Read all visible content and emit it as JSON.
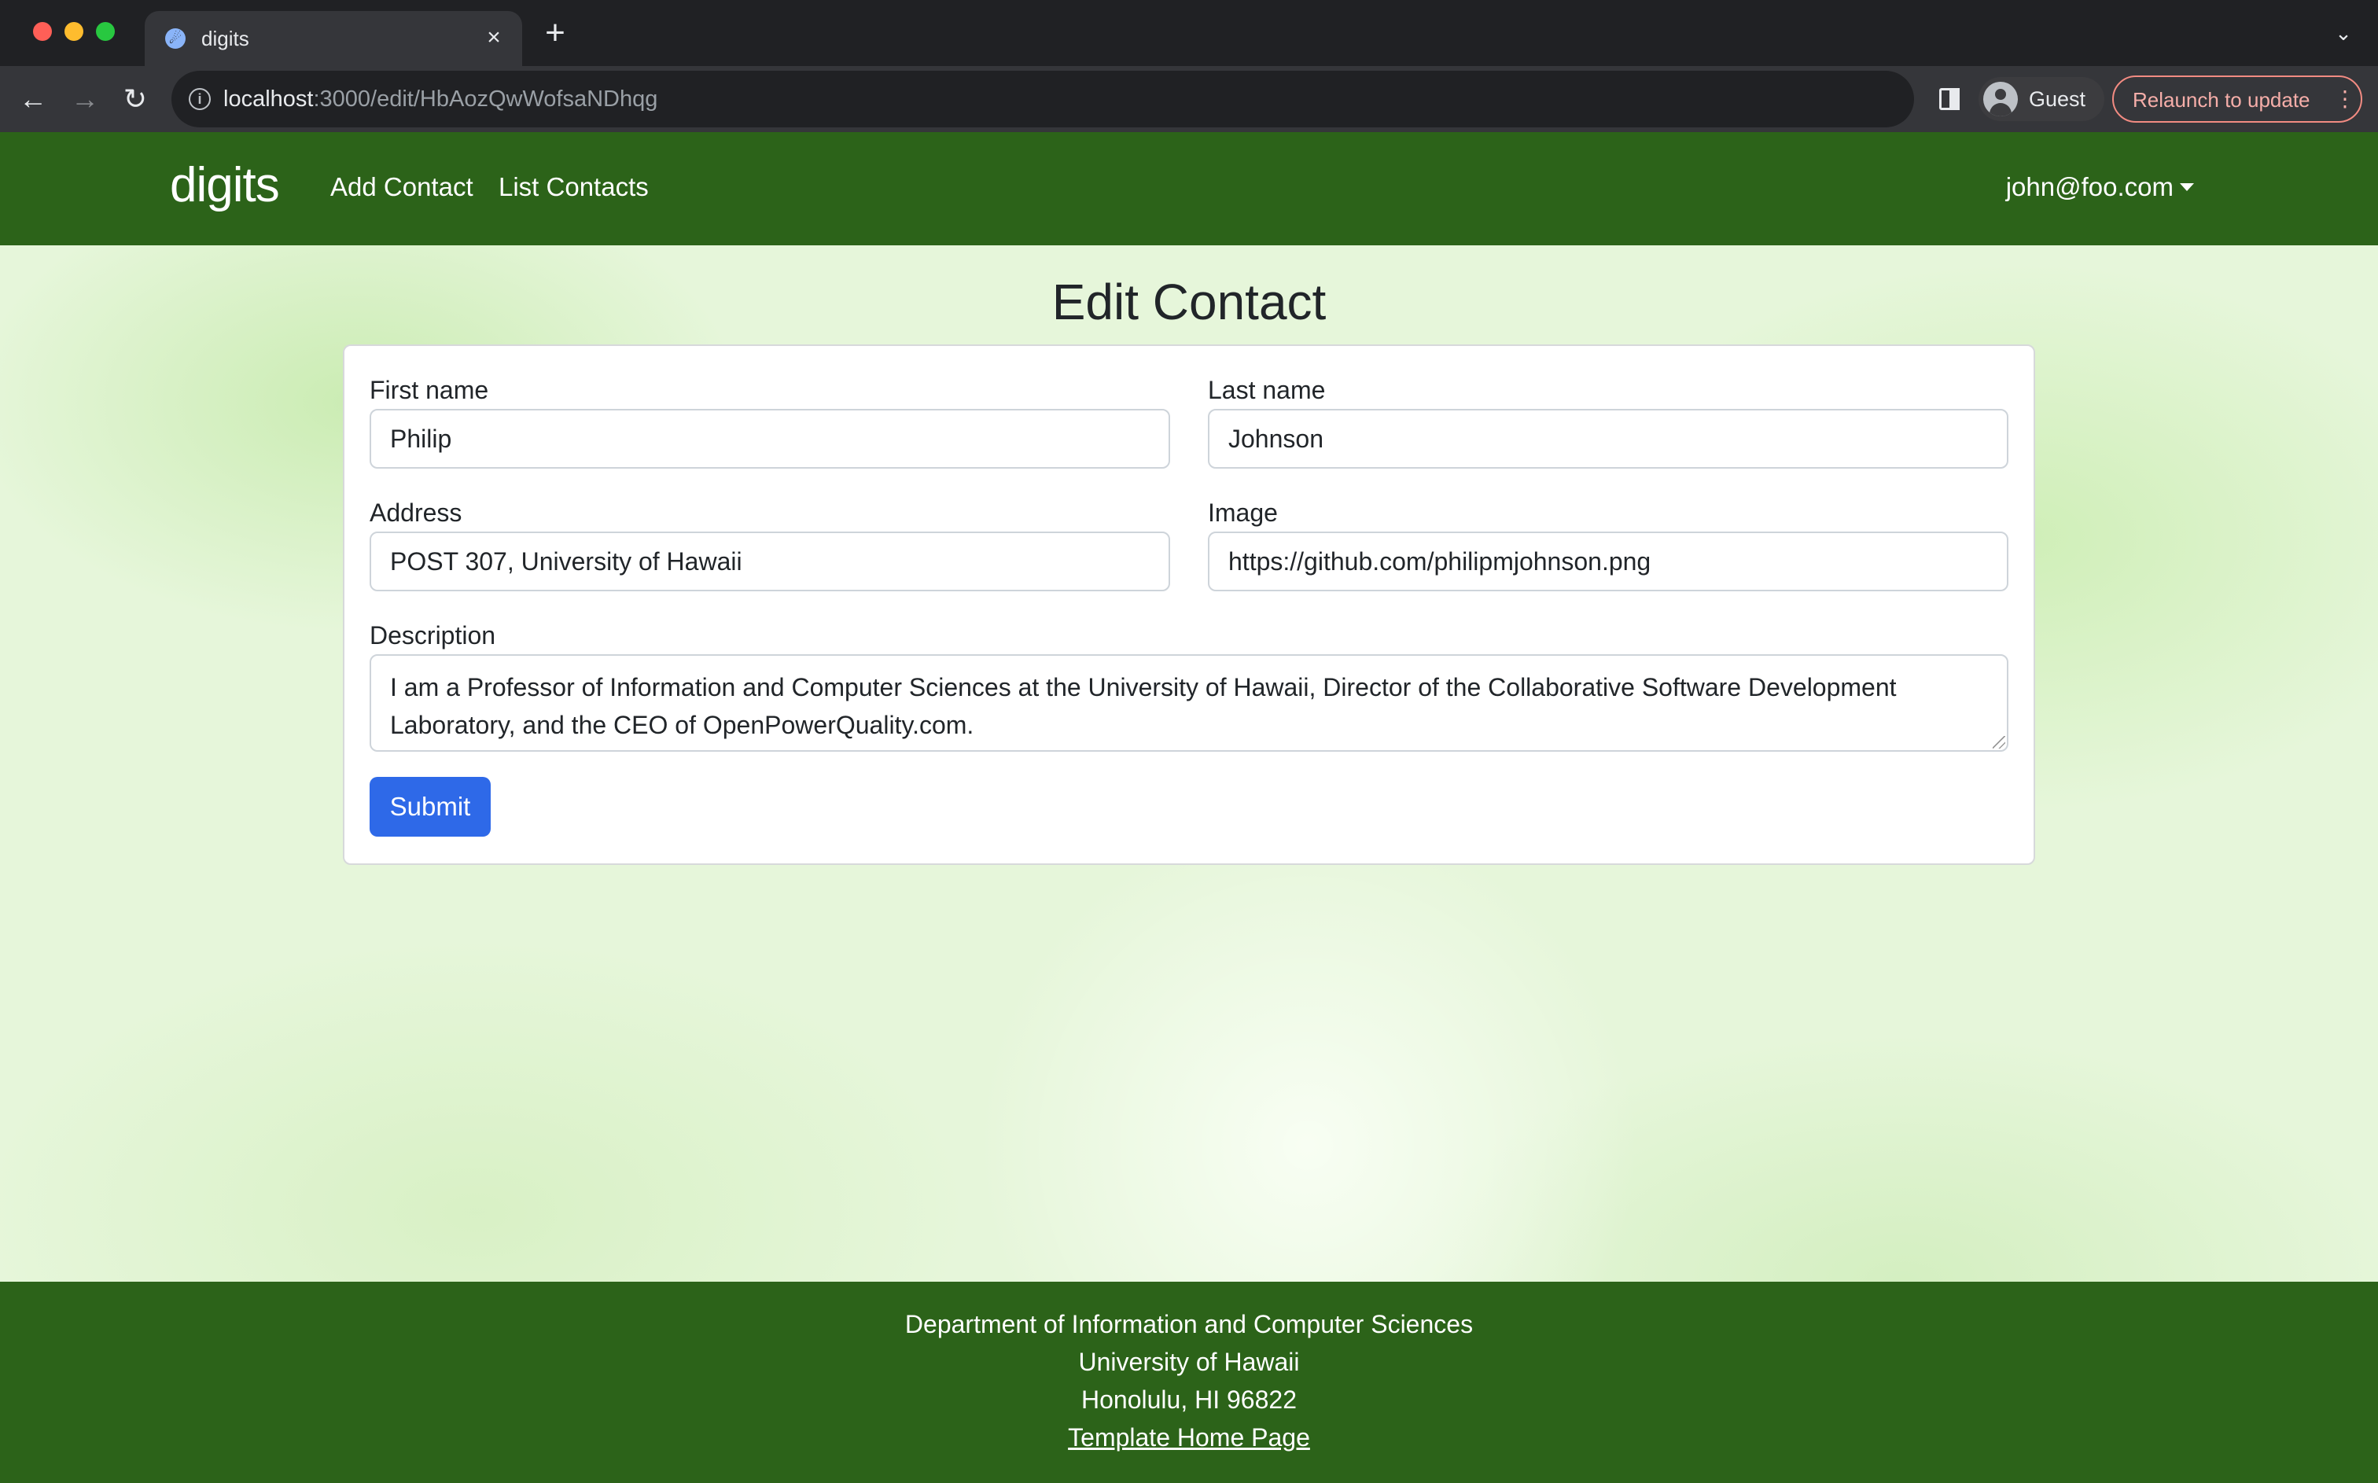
{
  "browser": {
    "tab": {
      "title": "digits",
      "favicon_icon": "meteor-favicon-icon"
    },
    "url": {
      "host": "localhost",
      "path": ":3000/edit/HbAozQwWofsaNDhqg"
    },
    "profile_label": "Guest",
    "relaunch_label": "Relaunch to update",
    "colors": {
      "chrome": "#202124",
      "toolbar": "#35363a",
      "relaunch_accent": "#f28b82"
    }
  },
  "navbar": {
    "brand": "digits",
    "links": [
      "Add Contact",
      "List Contacts"
    ],
    "user": "john@foo.com",
    "color": "#2c6319"
  },
  "page": {
    "title": "Edit Contact"
  },
  "form": {
    "first_name": {
      "label": "First name",
      "value": "Philip"
    },
    "last_name": {
      "label": "Last name",
      "value": "Johnson"
    },
    "address": {
      "label": "Address",
      "value": "POST 307, University of Hawaii"
    },
    "image": {
      "label": "Image",
      "value": "https://github.com/philipmjohnson.png"
    },
    "description": {
      "label": "Description",
      "value": "I am a Professor of Information and Computer Sciences at the University of Hawaii, Director of the Collaborative Software Development Laboratory, and the CEO of OpenPowerQuality.com."
    },
    "submit_label": "Submit",
    "submit_color": "#2e69e8"
  },
  "footer": {
    "lines": [
      "Department of Information and Computer Sciences",
      "University of Hawaii",
      "Honolulu, HI 96822"
    ],
    "link": "Template Home Page"
  }
}
